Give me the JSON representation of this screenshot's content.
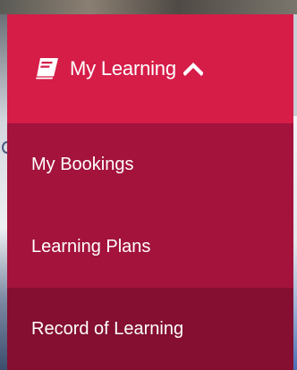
{
  "menu": {
    "header": {
      "label": "My Learning",
      "icon": "book-icon",
      "expand_icon": "chevron-up-icon"
    },
    "items": [
      {
        "label": "My Bookings"
      },
      {
        "label": "Learning Plans"
      },
      {
        "label": "Record of Learning"
      }
    ]
  },
  "colors": {
    "header_bg": "#d51d48",
    "item_bg": "#a3133c",
    "item_active_bg": "#840f31",
    "text": "#ffffff"
  }
}
